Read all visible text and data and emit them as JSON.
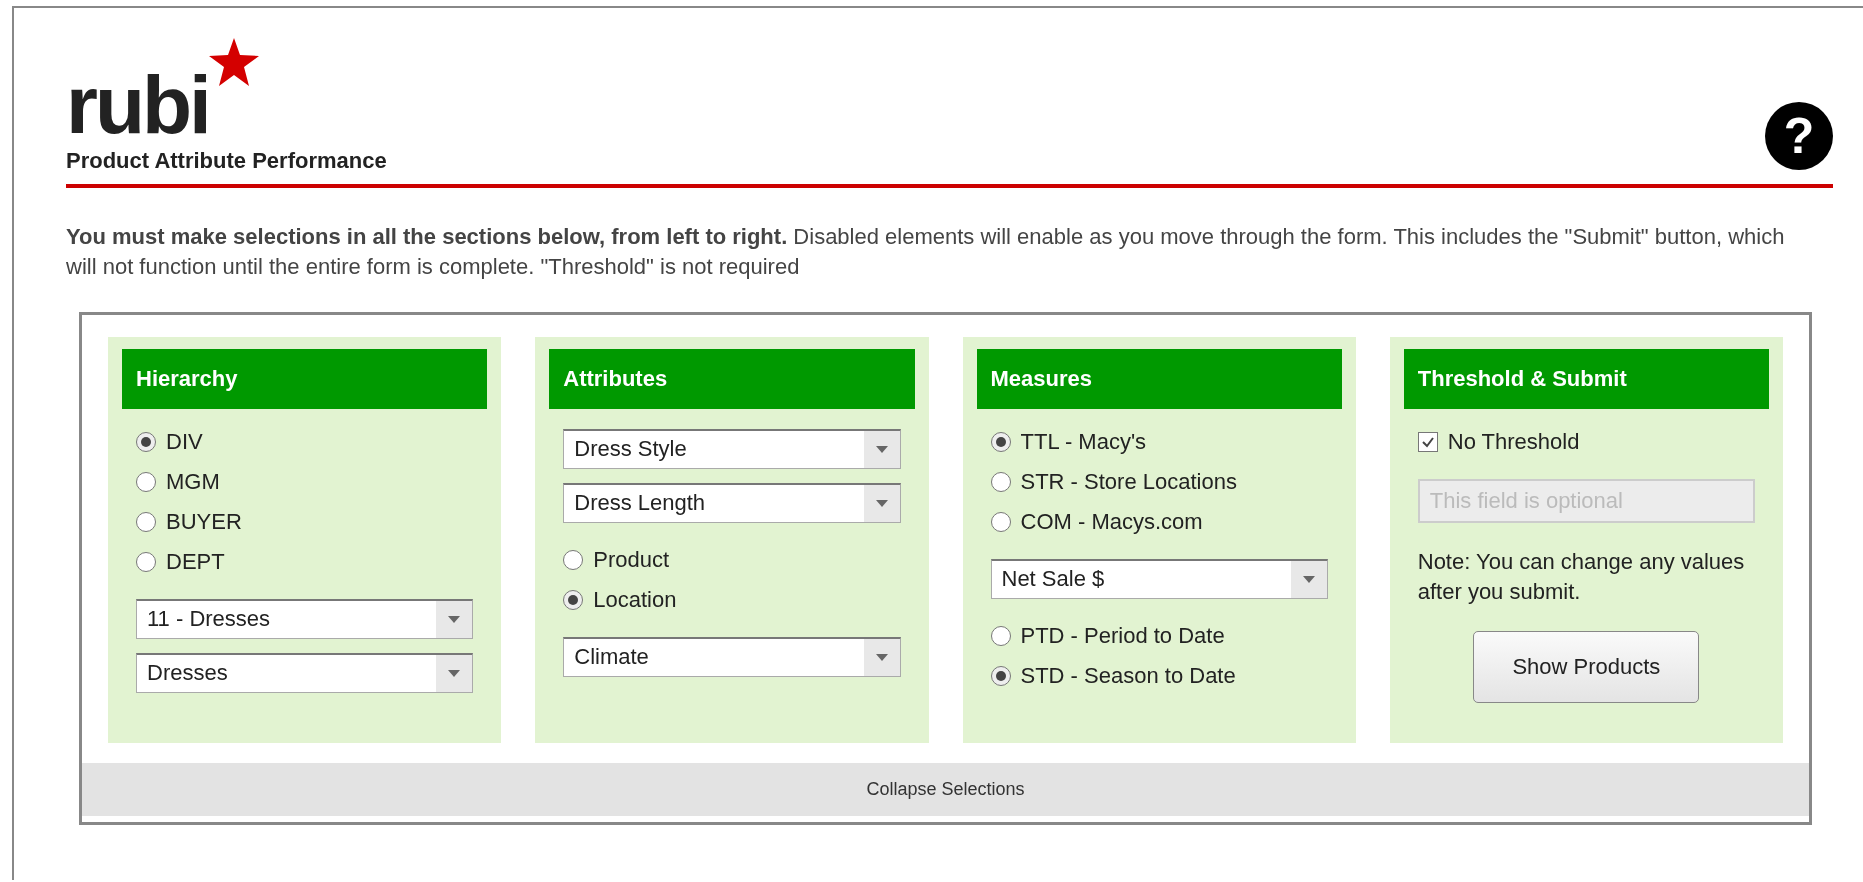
{
  "header": {
    "logo": "rubi",
    "subtitle": "Product Attribute Performance",
    "help": "?"
  },
  "instructions": "**You must make selections in all the sections below, from left to right.** Disabled elements will enable as you move through the form. This includes the \"Submit\" button, which will not function until the entire form is complete. \"Threshold\" is not required",
  "panels": [
    {
      "title": "Hierarchy",
      "groups": [
        [
          {
            "kind": "radio",
            "label": "DIV",
            "selected": true
          },
          {
            "kind": "radio",
            "label": "MGM",
            "selected": false
          },
          {
            "kind": "radio",
            "label": "BUYER",
            "selected": false
          },
          {
            "kind": "radio",
            "label": "DEPT",
            "selected": false
          }
        ],
        [
          {
            "kind": "select",
            "value": "11 - Dresses"
          },
          {
            "kind": "select",
            "value": "Dresses"
          }
        ]
      ]
    },
    {
      "title": "Attributes",
      "groups": [
        [
          {
            "kind": "select",
            "value": "Dress Style"
          },
          {
            "kind": "select",
            "value": "Dress Length"
          }
        ],
        [
          {
            "kind": "radio",
            "label": "Product",
            "selected": false
          },
          {
            "kind": "radio",
            "label": "Location",
            "selected": true
          }
        ],
        [
          {
            "kind": "select",
            "value": "Climate"
          }
        ]
      ]
    },
    {
      "title": "Measures",
      "groups": [
        [
          {
            "kind": "radio",
            "label": "TTL - Macy's",
            "selected": true
          },
          {
            "kind": "radio",
            "label": "STR - Store Locations",
            "selected": false
          },
          {
            "kind": "radio",
            "label": "COM - Macys.com",
            "selected": false
          }
        ],
        [
          {
            "kind": "select",
            "value": "Net Sale $"
          }
        ],
        [
          {
            "kind": "radio",
            "label": "PTD - Period to Date",
            "selected": false
          },
          {
            "kind": "radio",
            "label": "STD - Season to Date",
            "selected": true
          }
        ]
      ]
    },
    {
      "title": "Threshold & Submit",
      "groups": [
        [
          {
            "kind": "checkbox",
            "label": "No Threshold",
            "checked": true
          }
        ],
        [
          {
            "kind": "input",
            "placeholder": "This field is optional",
            "disabled": true
          }
        ],
        [
          {
            "kind": "note",
            "text": "Note: You can change any values after you submit."
          }
        ],
        [
          {
            "kind": "button",
            "label": "Show Products"
          }
        ]
      ]
    }
  ],
  "collapse": "Collapse Selections"
}
